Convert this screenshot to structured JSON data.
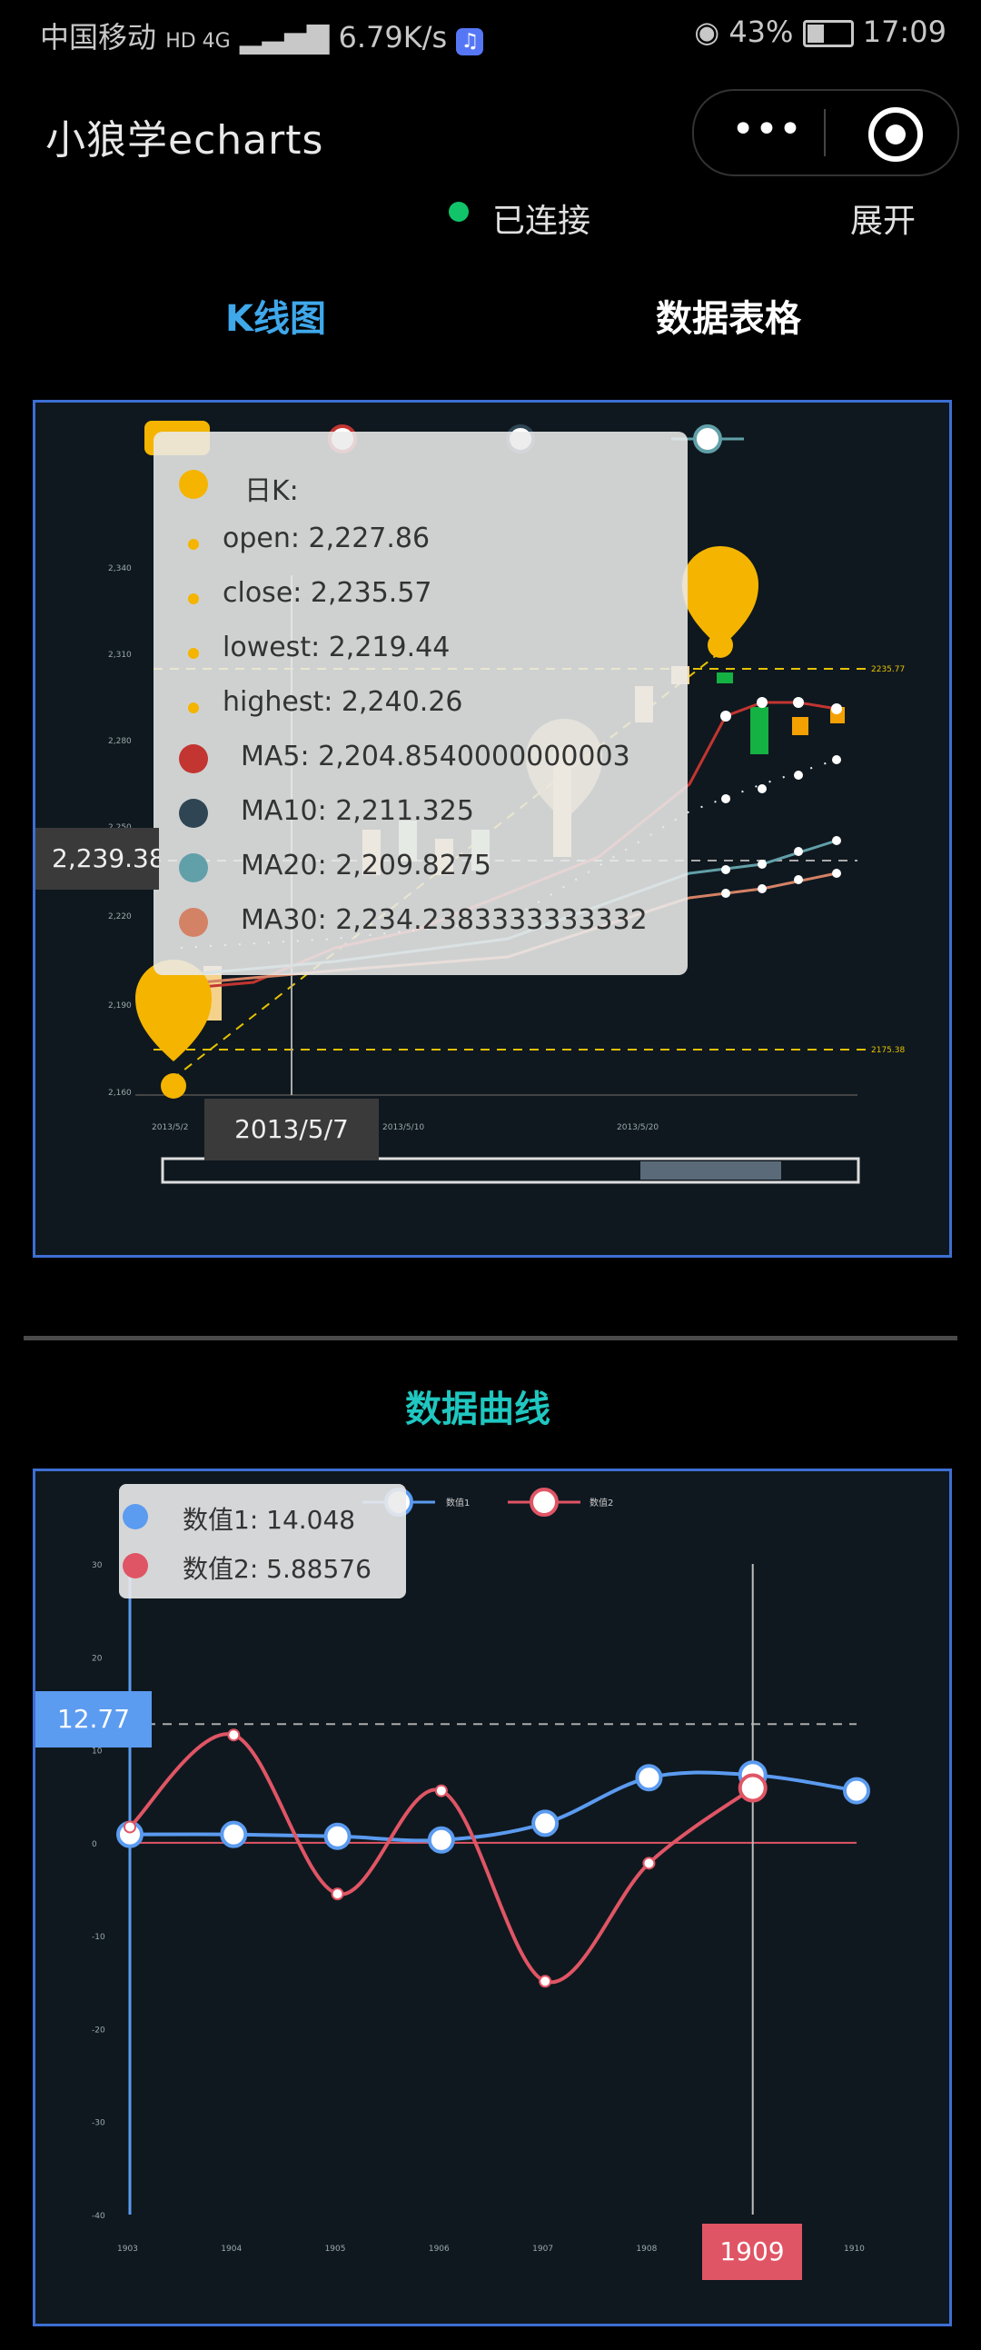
{
  "status_bar": {
    "carrier": "中国移动",
    "network": "HD 4G",
    "speed": "6.79K/s",
    "battery": "43%",
    "time": "17:09"
  },
  "nav": {
    "title": "小狼学echarts"
  },
  "connection": {
    "status": "已连接",
    "expand_label": "展开"
  },
  "tabs": [
    {
      "label": "K线图",
      "active": true,
      "color": "#3fa8ea"
    },
    {
      "label": "数据表格",
      "active": false
    }
  ],
  "kline": {
    "y_ticks": [
      "2,160",
      "2,190",
      "2,220",
      "2,250",
      "2,280",
      "2,310",
      "2,340"
    ],
    "x_ticks": [
      "2013/5/2",
      "2013/5/7",
      "2013/5/10",
      "2013/5/20"
    ],
    "markline_labels": [
      "2235.77",
      "2175.38"
    ],
    "cursor_value": "2,239.38",
    "cursor_date": "2013/5/7",
    "tooltip": {
      "title": "日K:",
      "rows": [
        {
          "text": "open: 2,227.86",
          "color": "#f4b400"
        },
        {
          "text": "close: 2,235.57",
          "color": "#f4b400"
        },
        {
          "text": "lowest: 2,219.44",
          "color": "#f4b400"
        },
        {
          "text": "highest: 2,240.26",
          "color": "#f4b400"
        },
        {
          "text": "MA5: 2,204.8540000000003",
          "color": "#c23531"
        },
        {
          "text": "MA10: 2,211.325",
          "color": "#2f4554"
        },
        {
          "text": "MA20: 2,209.8275",
          "color": "#61a0a8"
        },
        {
          "text": "MA30: 2,234.2383333333332",
          "color": "#d48265"
        }
      ]
    }
  },
  "section_title": "数据曲线",
  "line_chart": {
    "legend": [
      "数值1",
      "数值2"
    ],
    "tooltip": {
      "rows": [
        {
          "text": "数值1: 14.048",
          "color": "#5b9bf0"
        },
        {
          "text": "数值2: 5.88576",
          "color": "#e05565"
        }
      ]
    },
    "cursor_value": "12.77",
    "cursor_x": "1909",
    "y_ticks": [
      "30",
      "20",
      "10",
      "0",
      "-10",
      "-20",
      "-30",
      "-40"
    ],
    "x_ticks": [
      "1903",
      "1904",
      "1905",
      "1906",
      "1907",
      "1908",
      "1909",
      "1910"
    ]
  },
  "chart_data": [
    {
      "type": "line",
      "x": [
        "1903",
        "1904",
        "1905",
        "1906",
        "1907",
        "1908",
        "1909",
        "1910"
      ],
      "ylim": [
        -40,
        30
      ],
      "series": [
        {
          "name": "数值1",
          "color": "#5b9bf0",
          "values": [
            0.9,
            0.9,
            0.7,
            0.3,
            2.1,
            7.0,
            7.3,
            5.6
          ]
        },
        {
          "name": "数值2",
          "color": "#e05565",
          "values": [
            1.7,
            11.6,
            -5.5,
            5.6,
            -14.9,
            -2.2,
            5.9,
            null
          ]
        }
      ]
    }
  ]
}
